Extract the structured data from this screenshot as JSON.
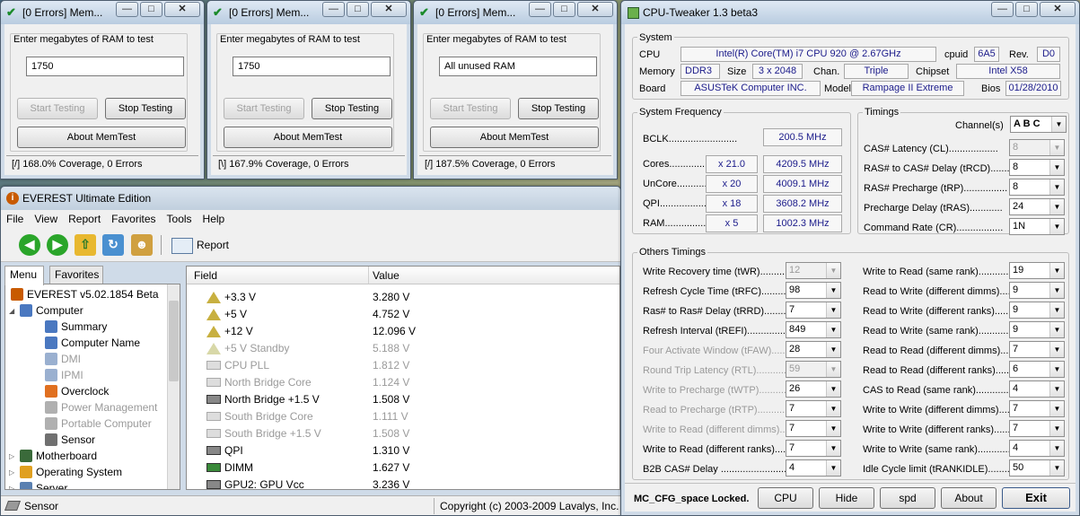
{
  "memtest_windows": [
    {
      "title": "[0 Errors] Mem...",
      "prompt": "Enter megabytes of RAM to test",
      "value": "1750",
      "start": "Start Testing",
      "stop": "Stop Testing",
      "about": "About MemTest",
      "status": "[/]  168.0% Coverage, 0 Errors"
    },
    {
      "title": "[0 Errors] Mem...",
      "prompt": "Enter megabytes of RAM to test",
      "value": "1750",
      "start": "Start Testing",
      "stop": "Stop Testing",
      "about": "About MemTest",
      "status": "[\\]  167.9% Coverage, 0 Errors"
    },
    {
      "title": "[0 Errors] Mem...",
      "prompt": "Enter megabytes of RAM to test",
      "value": "All unused RAM",
      "start": "Start Testing",
      "stop": "Stop Testing",
      "about": "About MemTest",
      "status": "[/]  187.5% Coverage, 0 Errors"
    }
  ],
  "everest": {
    "title": "EVEREST Ultimate Edition",
    "menu": [
      "File",
      "View",
      "Report",
      "Favorites",
      "Tools",
      "Help"
    ],
    "report_label": "Report",
    "tabs": [
      "Menu",
      "Favorites"
    ],
    "tree": [
      {
        "label": "EVEREST v5.02.1854 Beta",
        "grey": false
      },
      {
        "label": "Computer",
        "grey": false
      },
      {
        "label": "Summary",
        "grey": false
      },
      {
        "label": "Computer Name",
        "grey": false
      },
      {
        "label": "DMI",
        "grey": true
      },
      {
        "label": "IPMI",
        "grey": true
      },
      {
        "label": "Overclock",
        "grey": false
      },
      {
        "label": "Power Management",
        "grey": true
      },
      {
        "label": "Portable Computer",
        "grey": true
      },
      {
        "label": "Sensor",
        "grey": false
      },
      {
        "label": "Motherboard",
        "grey": false
      },
      {
        "label": "Operating System",
        "grey": false
      },
      {
        "label": "Server",
        "grey": false
      }
    ],
    "columns": {
      "field": "Field",
      "value": "Value"
    },
    "rows": [
      {
        "field": "+3.3 V",
        "value": "3.280 V",
        "grey": false
      },
      {
        "field": "+5 V",
        "value": "4.752 V",
        "grey": false
      },
      {
        "field": "+12 V",
        "value": "12.096 V",
        "grey": false
      },
      {
        "field": "+5 V Standby",
        "value": "5.188 V",
        "grey": true
      },
      {
        "field": "CPU PLL",
        "value": "1.812 V",
        "grey": true
      },
      {
        "field": "North Bridge Core",
        "value": "1.124 V",
        "grey": true
      },
      {
        "field": "North Bridge +1.5 V",
        "value": "1.508 V",
        "grey": false
      },
      {
        "field": "South Bridge Core",
        "value": "1.111 V",
        "grey": true
      },
      {
        "field": "South Bridge +1.5 V",
        "value": "1.508 V",
        "grey": true
      },
      {
        "field": "QPI",
        "value": "1.310 V",
        "grey": false
      },
      {
        "field": "DIMM",
        "value": "1.627 V",
        "grey": false
      },
      {
        "field": "GPU2: GPU Vcc",
        "value": "3.236 V",
        "grey": false
      }
    ],
    "status_left": "Sensor",
    "status_right": "Copyright (c) 2003-2009 Lavalys, Inc."
  },
  "tweaker": {
    "title": "CPU-Tweaker 1.3 beta3",
    "system": {
      "group": "System",
      "cpu_label": "CPU",
      "cpu": "Intel(R) Core(TM) i7 CPU       920  @ 2.67GHz",
      "cpuid_label": "cpuid",
      "cpuid": "6A5",
      "rev_label": "Rev.",
      "rev": "D0",
      "memory_label": "Memory",
      "memory": "DDR3",
      "size_label": "Size",
      "size": "3 x 2048",
      "chan_label": "Chan.",
      "chan": "Triple",
      "chipset_label": "Chipset",
      "chipset": "Intel X58",
      "board_label": "Board",
      "board": "ASUSTeK Computer INC.",
      "model_label": "Model",
      "model": "Rampage II Extreme",
      "bios_label": "Bios",
      "bios": "01/28/2010"
    },
    "freq": {
      "group": "System Frequency",
      "bclk_label": "BCLK.........................",
      "bclk": "200.5 MHz",
      "rows": [
        {
          "label": "Cores.............",
          "mult": "x 21.0",
          "value": "4209.5 MHz"
        },
        {
          "label": "UnCore............",
          "mult": "x 20",
          "value": "4009.1 MHz"
        },
        {
          "label": "QPI.................",
          "mult": "x 18",
          "value": "3608.2 MHz"
        },
        {
          "label": "RAM................",
          "mult": "x 5",
          "value": "1002.3 MHz"
        }
      ]
    },
    "timings": {
      "group": "Timings",
      "channel_label": "Channel(s)",
      "channel": "A B C",
      "rows": [
        {
          "label": "CAS# Latency (CL)..................",
          "value": "8",
          "disabled": true
        },
        {
          "label": "RAS# to CAS# Delay (tRCD).......",
          "value": "8",
          "disabled": false
        },
        {
          "label": "RAS# Precharge (tRP)................",
          "value": "8",
          "disabled": false
        },
        {
          "label": "Precharge Delay (tRAS)............",
          "value": "24",
          "disabled": false
        },
        {
          "label": "Command Rate (CR).................",
          "value": "1N",
          "disabled": false
        }
      ]
    },
    "others": {
      "group": "Others Timings",
      "left": [
        {
          "label": "Write Recovery time (tWR)..........",
          "value": "12",
          "disabled": true
        },
        {
          "label": "Refresh Cycle Time (tRFC)..........",
          "value": "98",
          "disabled": false
        },
        {
          "label": "Ras# to Ras# Delay (tRRD)..........",
          "value": "7",
          "disabled": false
        },
        {
          "label": "Refresh Interval (tREFI)..............",
          "value": "849",
          "disabled": false
        },
        {
          "label": "Four Activate Window (tFAW).......",
          "value": "28",
          "disabled": false,
          "grey": true
        },
        {
          "label": "Round Trip Latency (RTL)............",
          "value": "59",
          "disabled": true,
          "grey": true
        },
        {
          "label": "Write to Precharge (tWTP)...........",
          "value": "26",
          "disabled": false,
          "grey": true
        },
        {
          "label": "Read to Precharge (tRTP)............",
          "value": "7",
          "disabled": false,
          "grey": true
        },
        {
          "label": "Write to Read (different dimms)....",
          "value": "7",
          "disabled": false,
          "grey": true
        },
        {
          "label": "Write to Read (different ranks)....",
          "value": "7",
          "disabled": false
        },
        {
          "label": "B2B CAS# Delay .........................",
          "value": "4",
          "disabled": false
        }
      ],
      "right": [
        {
          "label": "Write to Read (same rank)...................",
          "value": "19"
        },
        {
          "label": "Read to Write (different dimms)...........",
          "value": "9"
        },
        {
          "label": "Read to Write (different ranks)...........",
          "value": "9"
        },
        {
          "label": "Read to Write (same rank)...................",
          "value": "9"
        },
        {
          "label": "Read to Read (different dimms)...........",
          "value": "7"
        },
        {
          "label": "Read to Read (different ranks)...........",
          "value": "6"
        },
        {
          "label": "CAS to Read (same rank)....................",
          "value": "4"
        },
        {
          "label": "Write to Write (different dimms)..........",
          "value": "7"
        },
        {
          "label": "Write to Write (different ranks)..........",
          "value": "7"
        },
        {
          "label": "Write to Write (same rank).................",
          "value": "4"
        },
        {
          "label": "Idle Cycle limit (tRANKIDLE)..............",
          "value": "50"
        }
      ]
    },
    "footer": {
      "locked": "MC_CFG_space Locked.",
      "cpu": "CPU",
      "hide": "Hide",
      "spd": "spd",
      "about": "About",
      "exit": "Exit"
    }
  }
}
